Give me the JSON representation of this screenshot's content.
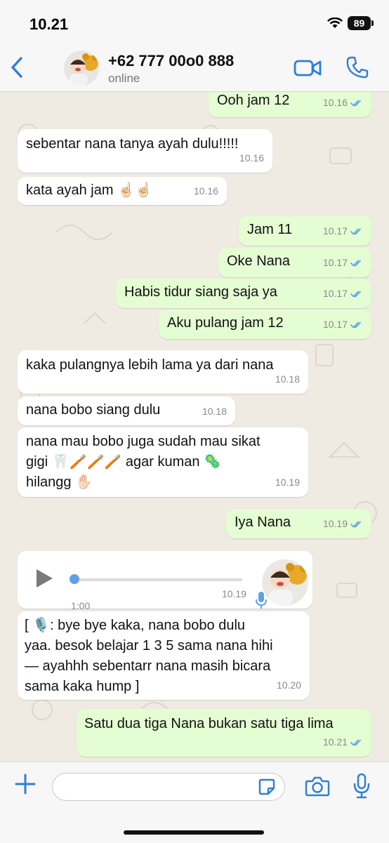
{
  "status_bar": {
    "time": "10.21",
    "battery": "89"
  },
  "header": {
    "contact_name": "+62 777 00o0 888",
    "contact_status": "online"
  },
  "messages": [
    {
      "dir": "out",
      "text": "Ooh jam 12",
      "time": "10.16",
      "read": true
    },
    {
      "dir": "in",
      "text": "sebentar nana tanya ayah dulu!!!!!",
      "time": "10.16"
    },
    {
      "dir": "in",
      "text": "kata ayah jam ☝🏻☝🏻",
      "time": "10.16"
    },
    {
      "dir": "out",
      "text": "Jam 11",
      "time": "10.17",
      "read": true
    },
    {
      "dir": "out",
      "text": "Oke Nana",
      "time": "10.17",
      "read": true
    },
    {
      "dir": "out",
      "text": "Habis tidur siang saja ya",
      "time": "10.17",
      "read": true
    },
    {
      "dir": "out",
      "text": "Aku pulang jam 12",
      "time": "10.17",
      "read": true
    },
    {
      "dir": "in",
      "text": "kaka pulangnya lebih lama ya dari nana",
      "time": "10.18"
    },
    {
      "dir": "in",
      "text": "nana bobo siang dulu",
      "time": "10.18"
    },
    {
      "dir": "in",
      "lines": [
        "nana mau bobo juga sudah mau sikat",
        "gigi 🦷🪥🪥🪥 agar kuman 🦠",
        "hilangg ✋🏻"
      ],
      "time": "10.19"
    },
    {
      "dir": "out",
      "text": "Iya Nana",
      "time": "10.19",
      "read": true
    },
    {
      "dir": "in",
      "type": "voice",
      "duration": "1:00",
      "time": "10.19"
    },
    {
      "dir": "in",
      "lines": [
        "[ 🎙️: bye bye kaka, nana bobo dulu",
        "yaa. besok belajar 1 3 5 sama nana hihi",
        "— ayahhh sebentarr nana masih bicara",
        "sama kaka hump ]"
      ],
      "time": "10.20"
    },
    {
      "dir": "out",
      "text": "Satu dua tiga Nana bukan satu tiga lima",
      "time": "10.21",
      "read": true
    }
  ],
  "input_bar": {
    "placeholder": ""
  },
  "colors": {
    "accent": "#2f7ed8",
    "outgoing": "#e4fdd3",
    "incoming": "#ffffff",
    "read_ticks": "#5ea1ea"
  },
  "icons": [
    "back-chevron-icon",
    "video-call-icon",
    "phone-icon",
    "play-icon",
    "mic-icon",
    "plus-icon",
    "sticker-icon",
    "camera-icon",
    "mic-icon"
  ]
}
